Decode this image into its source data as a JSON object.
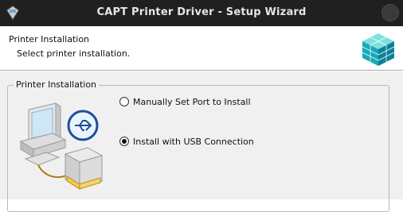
{
  "window": {
    "title": "CAPT Printer Driver - Setup Wizard"
  },
  "header": {
    "title": "Printer Installation",
    "subtitle": "Select printer installation."
  },
  "group": {
    "label": "Printer Installation"
  },
  "options": [
    {
      "label": "Manually Set Port to Install",
      "selected": false
    },
    {
      "label": "Install with USB Connection",
      "selected": true
    }
  ],
  "icons": {
    "app": "printer-setup-icon",
    "logo": "cube-blocks-icon",
    "illustration": "computer-usb-printer-illustration",
    "usb": "usb-icon"
  }
}
